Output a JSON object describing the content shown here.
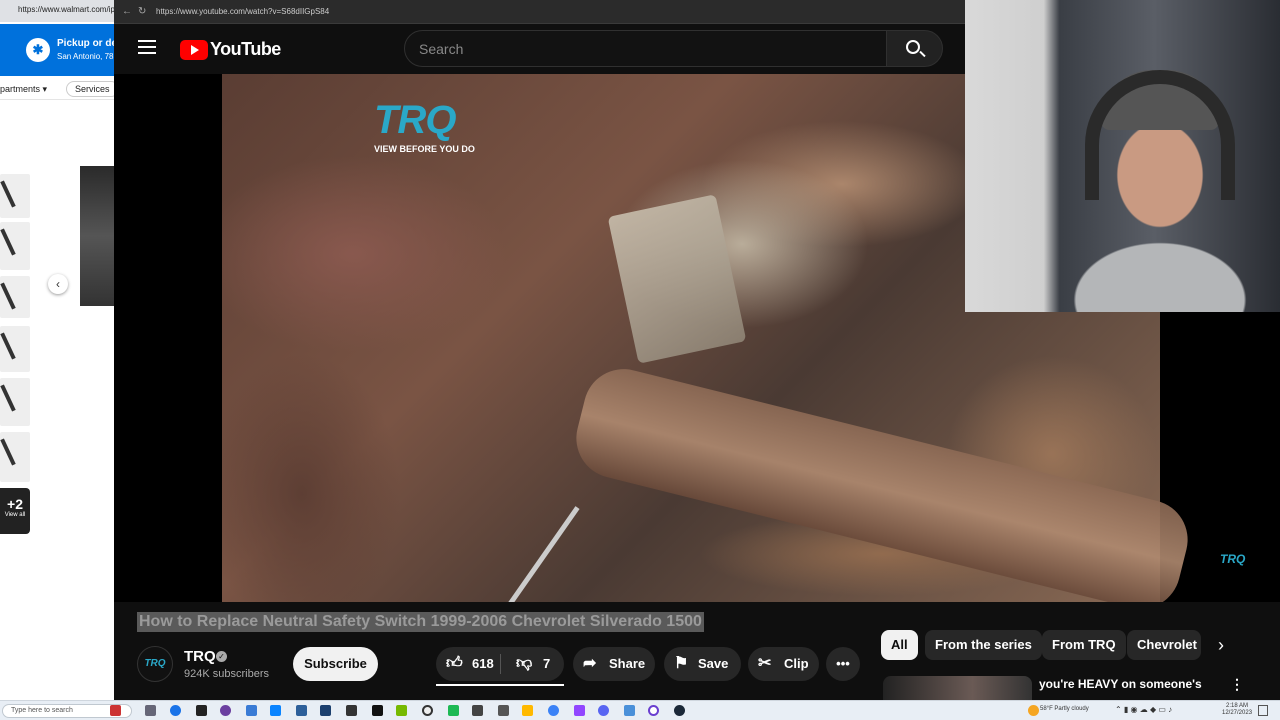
{
  "walmart": {
    "url": "https://www.walmart.com/ip/",
    "pickup_label": "Pickup or del",
    "location": "San Antonio, 78",
    "departments_label": "partments ▾",
    "services_label": "Services",
    "more_count": "+2",
    "view_all": "View all"
  },
  "browser": {
    "url": "https://www.youtube.com/watch?v=S68dIIGpS84"
  },
  "header": {
    "logo_text": "YouTube",
    "search_placeholder": "Search"
  },
  "video": {
    "overlay_logo": "TRQ",
    "overlay_tagline": "VIEW BEFORE YOU DO",
    "watermark": "TRQ"
  },
  "meta": {
    "title": "How to Replace Neutral Safety Switch 1999-2006 Chevrolet Silverado 1500",
    "channel_name": "TRQ",
    "avatar_text": "TRQ",
    "subscribers": "924K subscribers",
    "subscribe_label": "Subscribe",
    "likes": "618",
    "dislikes": "7",
    "share_label": "Share",
    "save_label": "Save",
    "clip_label": "Clip"
  },
  "chips": [
    "All",
    "From the series",
    "From TRQ",
    "Chevrolet"
  ],
  "recommended": {
    "title": "you're HEAVY on someone's"
  },
  "taskbar": {
    "search_placeholder": "Type here to search",
    "weather": "58°F  Partly cloudy",
    "time": "2:18 AM",
    "date": "12/27/2023"
  },
  "colors": {
    "youtube_red": "#ff0000",
    "trq_blue": "#2aa8c8",
    "walmart_blue": "#0071dc"
  }
}
